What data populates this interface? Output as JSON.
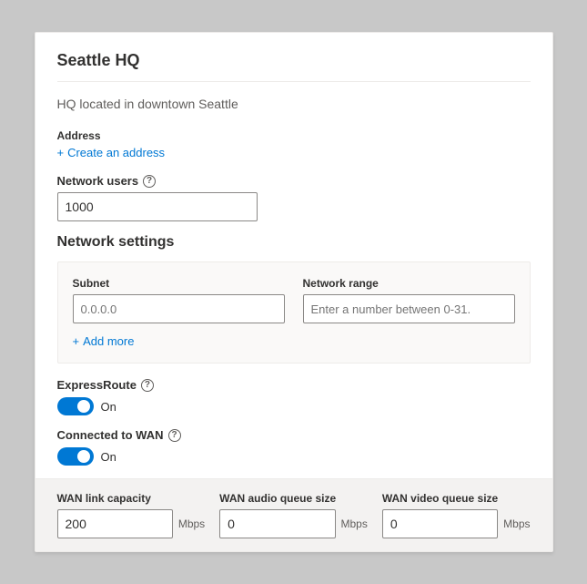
{
  "card": {
    "title": "Seattle HQ",
    "subtitle": "HQ located in downtown Seattle"
  },
  "address": {
    "label": "Address",
    "create_link_icon": "+",
    "create_link_text": "Create an address"
  },
  "network_users": {
    "label": "Network users",
    "value": "1000"
  },
  "network_settings": {
    "title": "Network settings",
    "subnet": {
      "label": "Subnet",
      "placeholder": "0.0.0.0"
    },
    "network_range": {
      "label": "Network range",
      "placeholder": "Enter a number between 0-31."
    },
    "add_more_icon": "+",
    "add_more_text": "Add more"
  },
  "express_route": {
    "label": "ExpressRoute",
    "toggle_on": "On",
    "checked": true
  },
  "connected_to_wan": {
    "label": "Connected to WAN",
    "toggle_on": "On",
    "checked": true
  },
  "wan_settings": {
    "link_capacity": {
      "label": "WAN link capacity",
      "value": "200",
      "unit": "Mbps"
    },
    "audio_queue": {
      "label": "WAN audio queue size",
      "value": "0",
      "unit": "Mbps"
    },
    "video_queue": {
      "label": "WAN video queue size",
      "value": "0",
      "unit": "Mbps"
    }
  }
}
